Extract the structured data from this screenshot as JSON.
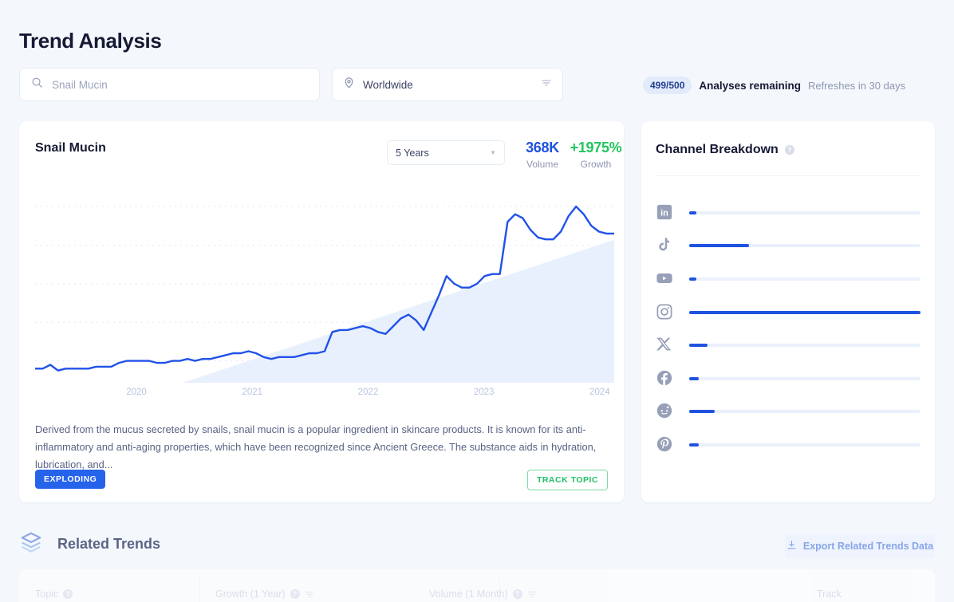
{
  "header": {
    "title": "Trend Analysis"
  },
  "search": {
    "placeholder": "Snail Mucin",
    "value": "",
    "icon": "search-icon"
  },
  "location": {
    "value": "Worldwide",
    "pin_icon": "map-pin-icon",
    "filter_icon": "filter-icon"
  },
  "quota": {
    "badge": "499/500",
    "label": "Analyses remaining",
    "refresh": "Refreshes in 30 days"
  },
  "trend": {
    "title": "Snail Mucin",
    "range": "5 Years",
    "range_options": [
      "5 Years"
    ],
    "volume_value": "368K",
    "volume_label": "Volume",
    "growth_value": "+1975%",
    "growth_label": "Growth",
    "description": "Derived from the mucus secreted by snails, snail mucin is a popular ingredient in skincare products. It is known for its anti-inflammatory and anti-aging properties, which have been recognized since Ancient Greece. The substance aids in hydration, lubrication, and...",
    "status_badge": "EXPLODING",
    "track_button": "TRACK TOPIC"
  },
  "chart_data": {
    "type": "line",
    "title": "Snail Mucin",
    "xlabel": "",
    "ylabel": "",
    "grid": true,
    "legend": false,
    "tick_labels": [
      "2020",
      "2021",
      "2022",
      "2023",
      "2024"
    ],
    "tick_positions": [
      0.175,
      0.375,
      0.575,
      0.775,
      0.975
    ],
    "ylim": [
      0,
      100
    ],
    "gridline_values": [
      8,
      28,
      48,
      68,
      88
    ],
    "line_color": "#2152e8",
    "wedge_color": "#e8f0fd",
    "values": [
      4,
      4,
      6,
      3,
      4,
      4,
      4,
      4,
      5,
      5,
      5,
      7,
      8,
      8,
      8,
      8,
      7,
      7,
      8,
      8,
      9,
      8,
      9,
      9,
      10,
      11,
      12,
      12,
      13,
      12,
      10,
      9,
      10,
      10,
      10,
      11,
      12,
      12,
      13,
      23,
      24,
      24,
      25,
      26,
      25,
      23,
      22,
      26,
      30,
      32,
      29,
      24,
      33,
      42,
      52,
      48,
      46,
      46,
      48,
      52,
      53,
      53,
      80,
      84,
      82,
      76,
      72,
      71,
      71,
      75,
      83,
      88,
      84,
      78,
      75,
      74,
      74
    ]
  },
  "channels": {
    "title": "Channel Breakdown",
    "help_icon": "help-circle-icon",
    "items": [
      {
        "name": "LinkedIn",
        "icon": "linkedin-icon",
        "percent": 3
      },
      {
        "name": "TikTok",
        "icon": "tiktok-icon",
        "percent": 26
      },
      {
        "name": "YouTube",
        "icon": "youtube-icon",
        "percent": 3
      },
      {
        "name": "Instagram",
        "icon": "instagram-icon",
        "percent": 100
      },
      {
        "name": "X",
        "icon": "x-twitter-icon",
        "percent": 8
      },
      {
        "name": "Facebook",
        "icon": "facebook-icon",
        "percent": 4
      },
      {
        "name": "Reddit",
        "icon": "reddit-icon",
        "percent": 11
      },
      {
        "name": "Pinterest",
        "icon": "pinterest-icon",
        "percent": 4
      }
    ]
  },
  "related": {
    "title": "Related Trends",
    "icon": "layers-icon",
    "export_label": "Export Related Trends Data",
    "export_icon": "download-icon",
    "columns": [
      "Topic",
      "Growth (1 Year)",
      "Volume (1 Month)",
      "Track"
    ]
  }
}
